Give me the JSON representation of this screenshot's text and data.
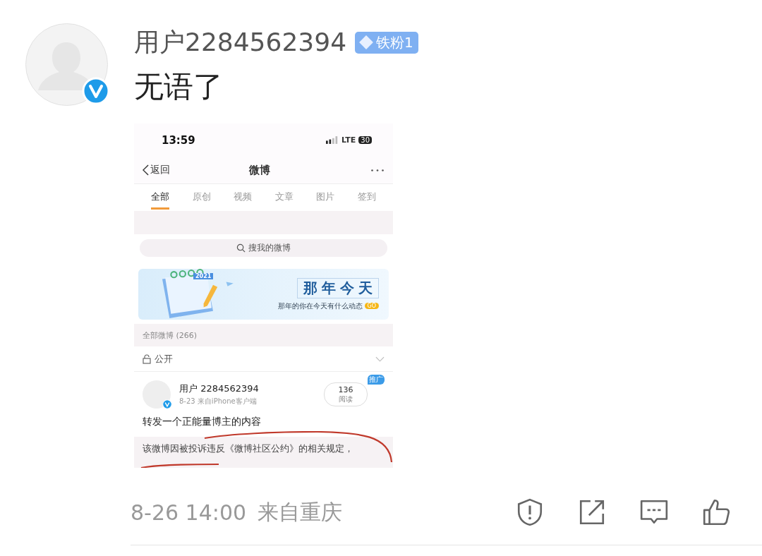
{
  "comment": {
    "username": "用户2284562394",
    "fan_badge": "铁粉1",
    "verified": true,
    "text": "无语了"
  },
  "screenshot": {
    "status_bar": {
      "time": "13:59",
      "network": "LTE",
      "battery": "30"
    },
    "nav": {
      "back": "返回",
      "title": "微博"
    },
    "tabs": [
      {
        "label": "全部",
        "selected": true
      },
      {
        "label": "原创",
        "selected": false
      },
      {
        "label": "视频",
        "selected": false
      },
      {
        "label": "文章",
        "selected": false
      },
      {
        "label": "图片",
        "selected": false
      },
      {
        "label": "签到",
        "selected": false
      }
    ],
    "search": {
      "placeholder": "搜我的微博"
    },
    "banner": {
      "year": "2021",
      "title": "那年今天",
      "subtitle": "那年的你在今天有什么动态",
      "button": "GO"
    },
    "section_header": "全部微博 (266)",
    "filter": "公开",
    "post": {
      "username": "用户 2284562394",
      "verified": true,
      "meta": "8-23 来自iPhone客户端",
      "reads": "136",
      "reads_label": "阅读",
      "promo": "推广",
      "text": "转发一个正能量博主的内容",
      "notice": "该微博因被投诉违反《微博社区公约》的相关规定，"
    }
  },
  "footer": {
    "time": "8-26 14:00",
    "location": "来自重庆"
  }
}
